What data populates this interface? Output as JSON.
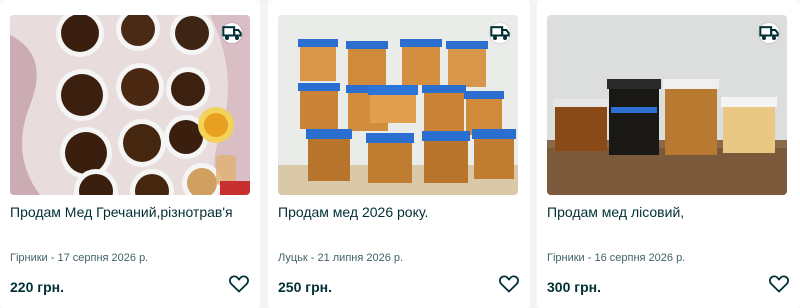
{
  "listings": [
    {
      "title": "Продам Мед Гречаний,різнотрав'я",
      "meta": "Гірники - 17 серпня 2026 р.",
      "price": "220 грн."
    },
    {
      "title": "Продам мед 2026 року.",
      "meta": "Луцьк - 21 липня 2026 р.",
      "price": "250 грн."
    },
    {
      "title": "Продам мед лісовий,",
      "meta": "Гірники - 16 серпня 2026 р.",
      "price": "300 грн."
    }
  ],
  "icons": {
    "delivery": "delivery-truck-icon",
    "favorite": "heart-outline-icon"
  },
  "colors": {
    "text": "#002f34",
    "meta": "#406367",
    "background": "#f2f4f5"
  }
}
